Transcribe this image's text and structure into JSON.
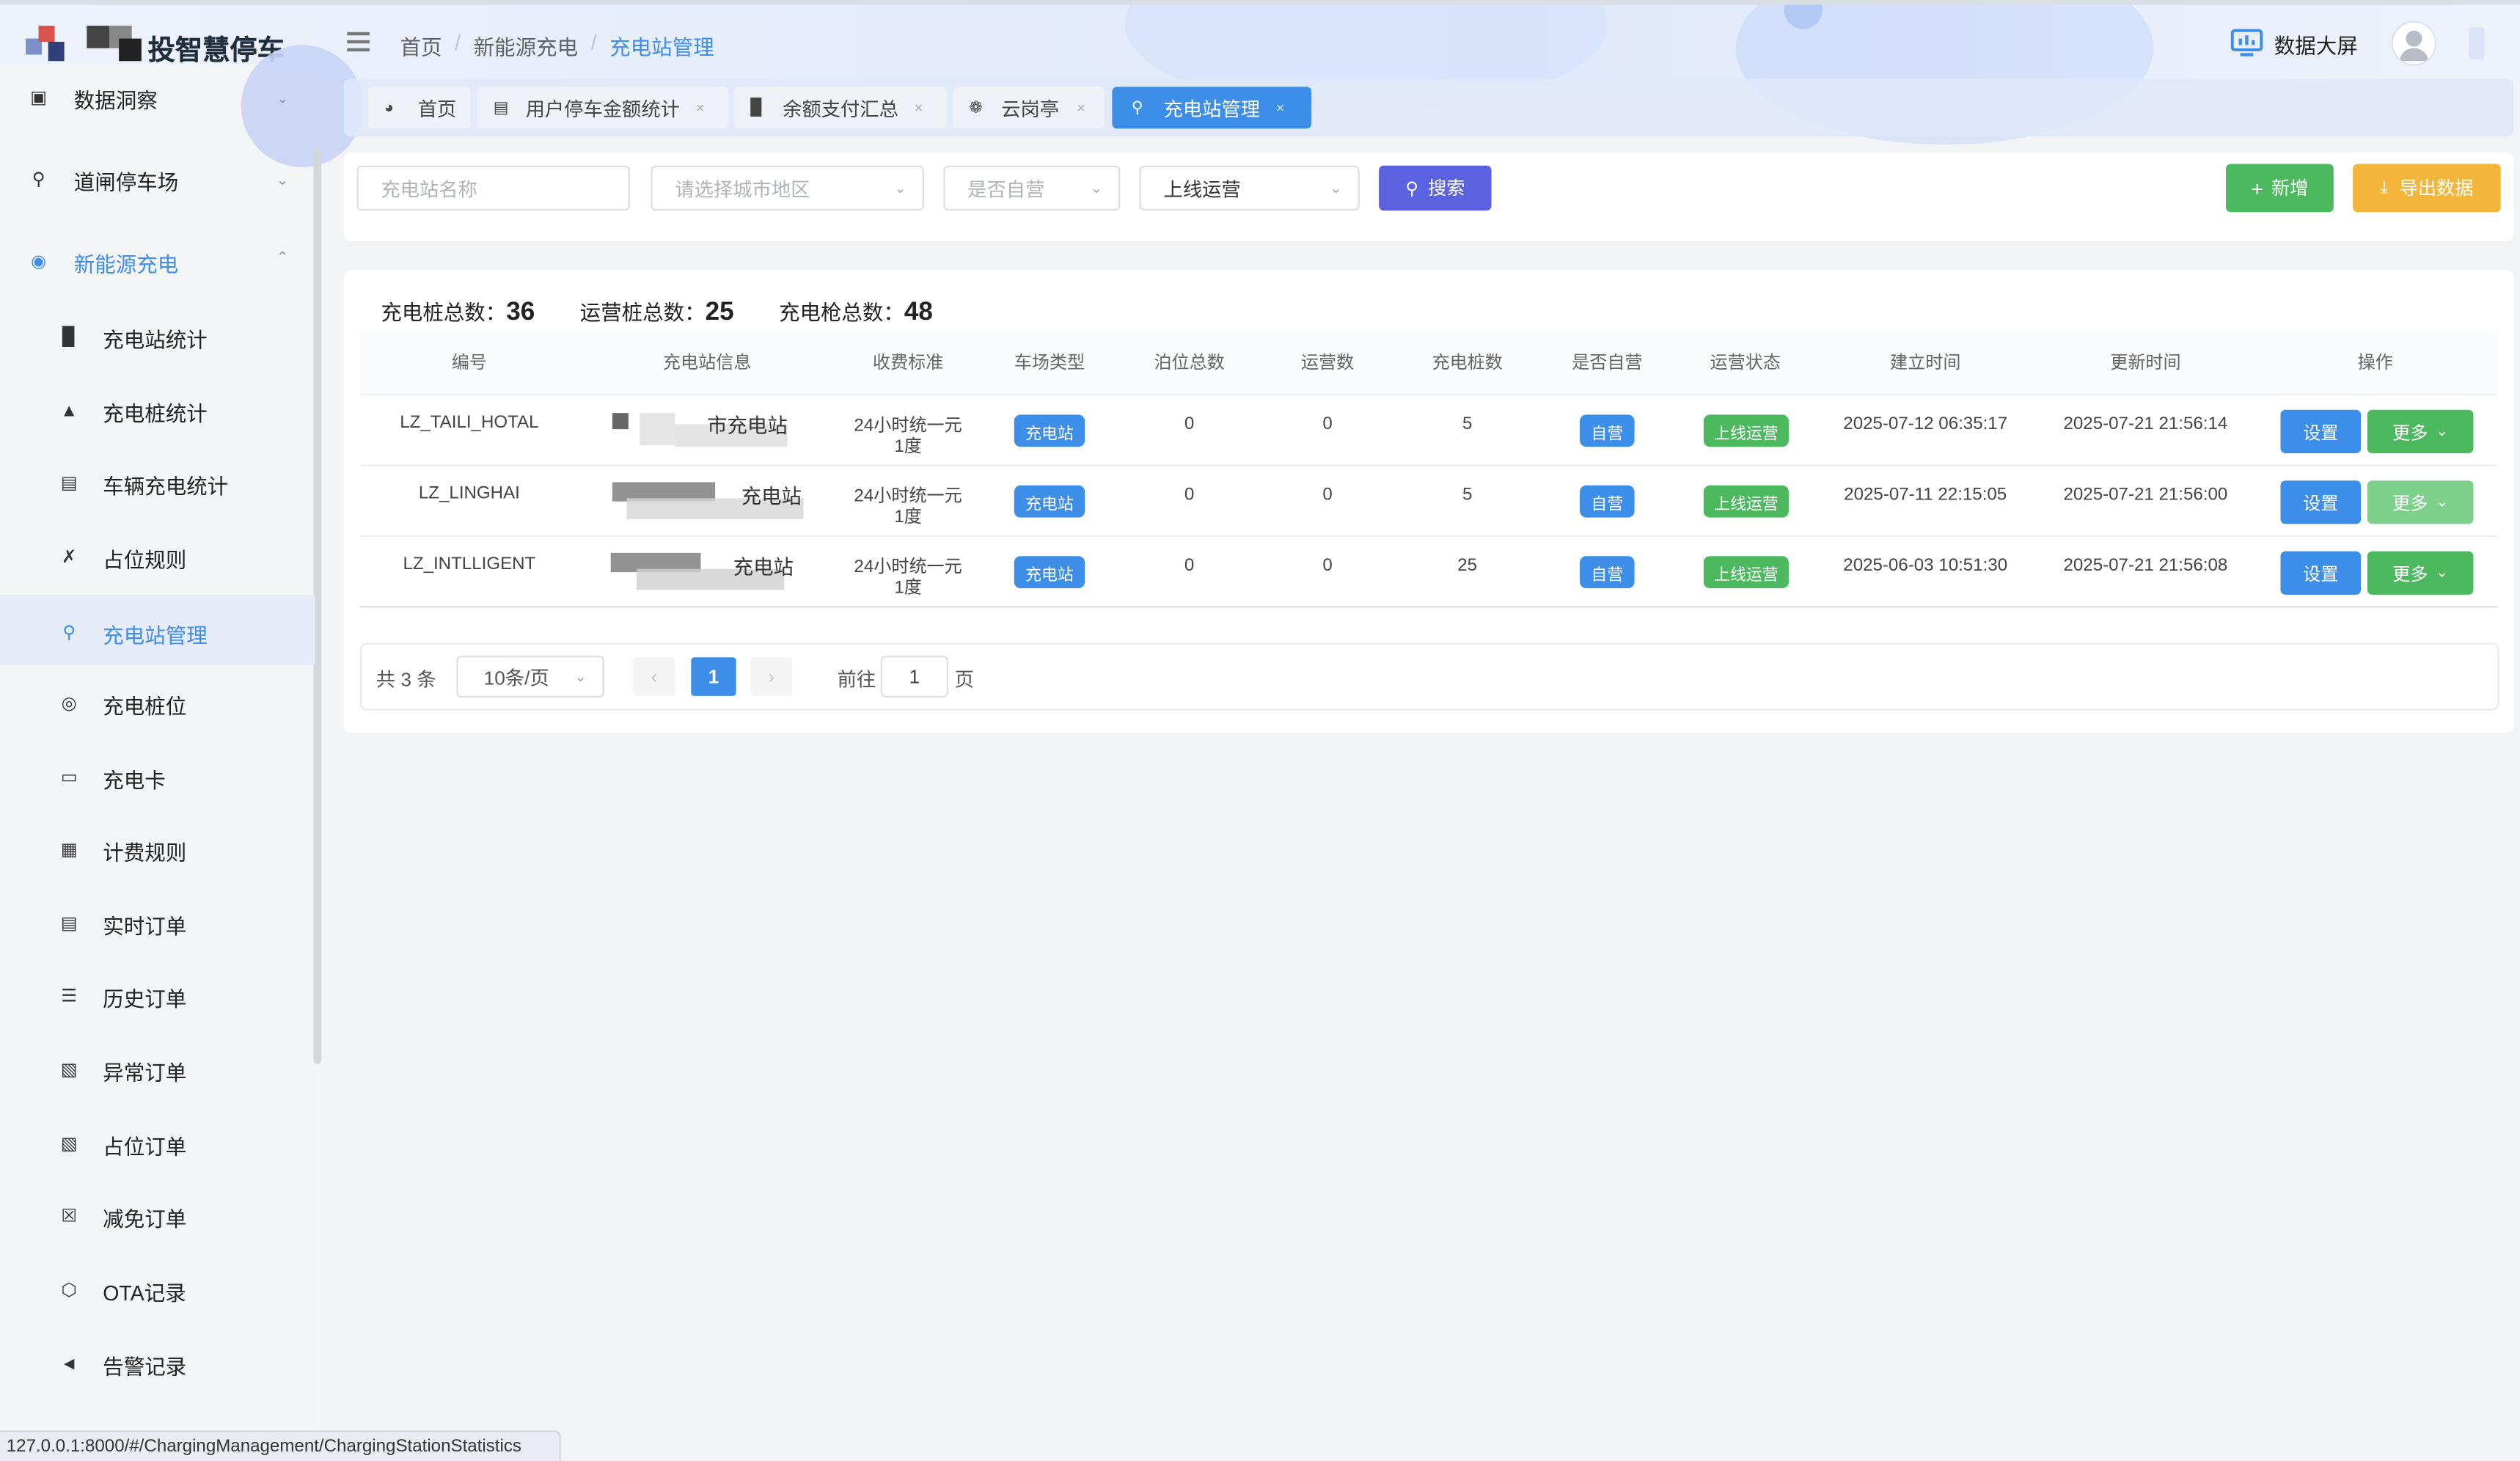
{
  "header": {
    "logo_text": "投智慧停车",
    "breadcrumb": [
      "首页",
      "新能源充电",
      "充电站管理"
    ],
    "breadcrumb_sep": "/",
    "dashboard_label": "数据大屏"
  },
  "sidebar": {
    "top_items": [
      {
        "label": "数据洞察",
        "icon": "monitor-chart-icon"
      },
      {
        "label": "道闸停车场",
        "icon": "location-pin-icon"
      },
      {
        "label": "新能源充电",
        "icon": "energy-icon"
      }
    ],
    "sub_items": [
      {
        "label": "充电站统计",
        "icon": "bar-chart-icon"
      },
      {
        "label": "充电桩统计",
        "icon": "pile-icon"
      },
      {
        "label": "车辆充电统计",
        "icon": "screen-icon"
      },
      {
        "label": "占位规则",
        "icon": "rule-icon"
      },
      {
        "label": "充电站管理",
        "icon": "location-icon"
      },
      {
        "label": "充电桩位",
        "icon": "target-icon"
      },
      {
        "label": "充电卡",
        "icon": "card-icon"
      },
      {
        "label": "计费规则",
        "icon": "billing-icon"
      },
      {
        "label": "实时订单",
        "icon": "order-icon"
      },
      {
        "label": "历史订单",
        "icon": "database-icon"
      },
      {
        "label": "异常订单",
        "icon": "abnormal-order-icon"
      },
      {
        "label": "占位订单",
        "icon": "occupy-order-icon"
      },
      {
        "label": "减免订单",
        "icon": "discount-order-icon"
      },
      {
        "label": "OTA记录",
        "icon": "cube-icon"
      },
      {
        "label": "告警记录",
        "icon": "speaker-icon"
      }
    ]
  },
  "tabs": [
    {
      "label": "首页",
      "icon": "dashboard-icon"
    },
    {
      "label": "用户停车金额统计",
      "icon": "screen-icon"
    },
    {
      "label": "余额支付汇总",
      "icon": "bar-chart-icon"
    },
    {
      "label": "云岗亭",
      "icon": "grid-icon"
    },
    {
      "label": "充电站管理",
      "icon": "location-icon"
    }
  ],
  "tab_close": "×",
  "filters": {
    "name_placeholder": "充电站名称",
    "region_placeholder": "请选择城市地区",
    "self_placeholder": "是否自营",
    "status_value": "上线运营",
    "search_label": "搜索",
    "add_label": "新增",
    "export_label": "导出数据"
  },
  "stats": [
    {
      "label": "充电桩总数：",
      "value": "36"
    },
    {
      "label": "运营桩总数：",
      "value": "25"
    },
    {
      "label": "充电枪总数：",
      "value": "48"
    }
  ],
  "table": {
    "headers": [
      "编号",
      "充电站信息",
      "收费标准",
      "车场类型",
      "泊位总数",
      "运营数",
      "充电桩数",
      "是否自营",
      "运营状态",
      "建立时间",
      "更新时间",
      "操作"
    ],
    "rows": [
      {
        "code": "LZ_TAILI_HOTAL",
        "station": "市充电站",
        "fee_line1": "24小时统一元",
        "fee_line2": "1度",
        "type": "充电站",
        "berths": "0",
        "operating": "0",
        "piles": "5",
        "self_run": "自营",
        "status": "上线运营",
        "created": "2025-07-12 06:35:17",
        "updated": "2025-07-21 21:56:14"
      },
      {
        "code": "LZ_LINGHAI",
        "station": "充电站",
        "fee_line1": "24小时统一元",
        "fee_line2": "1度",
        "type": "充电站",
        "berths": "0",
        "operating": "0",
        "piles": "5",
        "self_run": "自营",
        "status": "上线运营",
        "created": "2025-07-11 22:15:05",
        "updated": "2025-07-21 21:56:00"
      },
      {
        "code": "LZ_INTLLIGENT",
        "station": "充电站",
        "fee_line1": "24小时统一元",
        "fee_line2": "1度",
        "type": "充电站",
        "berths": "0",
        "operating": "0",
        "piles": "25",
        "self_run": "自营",
        "status": "上线运营",
        "created": "2025-06-03 10:51:30",
        "updated": "2025-07-21 21:56:08"
      }
    ],
    "settings_label": "设置",
    "more_label": "更多"
  },
  "pagination": {
    "total_text": "共 3 条",
    "page_size": "10条/页",
    "current_page": "1",
    "goto_label": "前往",
    "goto_value": "1",
    "page_unit": "页"
  },
  "status_bar": {
    "url": "127.0.0.1:8000/#/ChargingManagement/ChargingStationStatistics"
  },
  "colors": {
    "primary": "#3d8ee8",
    "success": "#4cb95e",
    "warning": "#f3b63b",
    "search": "#5b62e0",
    "active_text": "#3f8df0"
  }
}
